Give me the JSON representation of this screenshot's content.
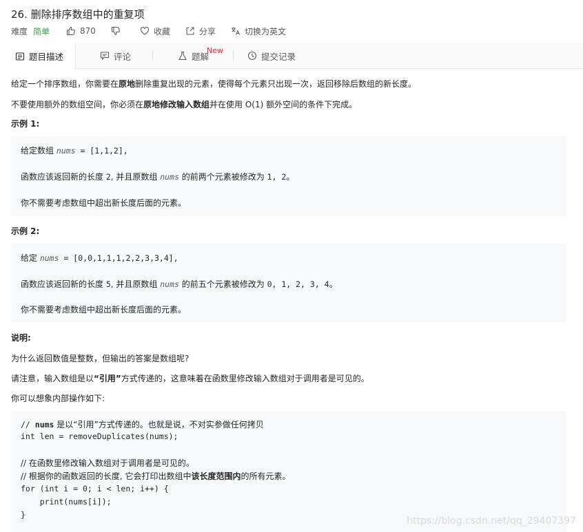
{
  "problem": {
    "title": "26. 删除排序数组中的重复项",
    "difficulty_label": "难度",
    "difficulty_value": "简单",
    "likes": "870",
    "favorite_label": "收藏",
    "share_label": "分享",
    "switch_lang_label": "切换为英文"
  },
  "tabs": [
    {
      "label": "题目描述",
      "icon": "description-icon"
    },
    {
      "label": "评论",
      "icon": "comment-icon"
    },
    {
      "label": "题解",
      "icon": "flask-icon",
      "badge": "New"
    },
    {
      "label": "提交记录",
      "icon": "history-icon"
    }
  ],
  "description": {
    "p1_a": "给定一个排序数组，你需要在",
    "p1_hl": "原地",
    "p1_b": "删除重复出现的元素，使得每个元素只出现一次，返回移除后数组的新长度。",
    "p2_a": "不要使用额外的数组空间，你必须在",
    "p2_hl1": "原地",
    "p2_hl2": "修改输入数组",
    "p2_b": "并在使用 O(1) 额外空间的条件下完成。"
  },
  "example1": {
    "title": "示例 1:",
    "l1_a": "给定数组 ",
    "l1_var": "nums",
    "l1_code": " = [1,1,2],",
    "l2_a": "函数应该返回新的长度 ",
    "l2_code1": "2",
    "l2_b": ", 并且原数组 ",
    "l2_var": "nums",
    "l2_c": " 的前两个元素被修改为 ",
    "l2_code2": "1, 2",
    "l2_d": "。",
    "l3": "你不需要考虑数组中超出新长度后面的元素。"
  },
  "example2": {
    "title": "示例 2:",
    "l1_a": "给定 ",
    "l1_var": "nums",
    "l1_code": " = [0,0,1,1,1,2,2,3,3,4],",
    "l2_a": "函数应该返回新的长度 ",
    "l2_code1": "5",
    "l2_b": ", 并且原数组 ",
    "l2_var": "nums",
    "l2_c": " 的前五个元素被修改为 ",
    "l2_code2": "0, 1, 2, 3, 4",
    "l2_d": "。",
    "l3": "你不需要考虑数组中超出新长度后面的元素。"
  },
  "note": {
    "title": "说明:",
    "p1": "为什么返回数值是整数，但输出的答案是数组呢?",
    "p2_a": "请注意，输入数组是以",
    "p2_hl": "“引用”",
    "p2_b": "方式传递的，这意味着在函数里修改输入数组对于调用者是可见的。",
    "p3": "你可以想象内部操作如下:"
  },
  "code": {
    "c1_a": "// ",
    "c1_hl": "nums",
    "c1_b": " 是以“引用”方式传递的。也就是说，不对实参做任何拷贝",
    "c2": "int len = removeDuplicates(nums);",
    "c3": "// 在函数里修改输入数组对于调用者是可见的。",
    "c4_a": "// 根据你的函数返回的长度, 它会打印出数组中",
    "c4_hl": "该长度范围内",
    "c4_b": "的所有元素。",
    "c5": "for (int i = 0; i < len; i++) {",
    "c6": "    print(nums[i]);",
    "c7": "}"
  },
  "watermark": "https://blog.csdn.net/qq_29407397"
}
